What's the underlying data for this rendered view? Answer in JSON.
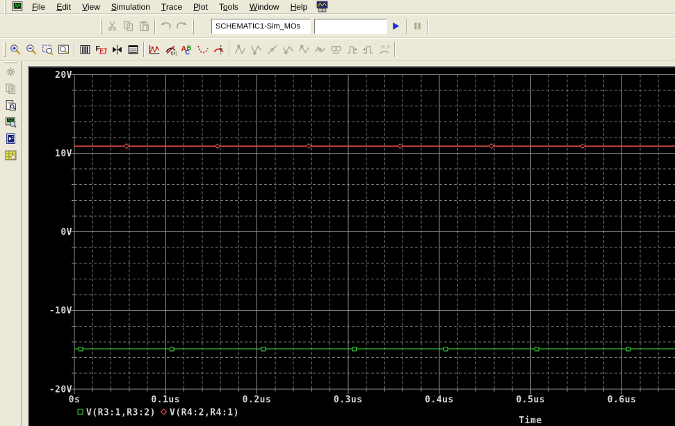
{
  "menu_bar": {
    "window_icon": "pspice-document-icon",
    "trailing_icon": "simulation-profile-icon",
    "items": [
      {
        "label": "File",
        "u": 0
      },
      {
        "label": "Edit",
        "u": 0
      },
      {
        "label": "View",
        "u": 0
      },
      {
        "label": "Simulation",
        "u": 0
      },
      {
        "label": "Trace",
        "u": 0
      },
      {
        "label": "Plot",
        "u": 0
      },
      {
        "label": "Tools",
        "u": 1
      },
      {
        "label": "Window",
        "u": 0
      },
      {
        "label": "Help",
        "u": 0
      }
    ]
  },
  "toolbar_standard": {
    "edit_buttons": [
      {
        "name": "cut-button",
        "icon": "scissors",
        "disabled": true
      },
      {
        "name": "copy-button",
        "icon": "copy",
        "disabled": true
      },
      {
        "name": "paste-button",
        "icon": "paste",
        "disabled": true
      },
      {
        "sep": true
      },
      {
        "name": "undo-button",
        "icon": "undo",
        "disabled": true
      },
      {
        "name": "redo-button",
        "icon": "redo",
        "disabled": true
      }
    ],
    "profile_combo": {
      "value": "SCHEMATIC1-Sim_MOs"
    },
    "status_field": {
      "value": ""
    },
    "run_buttons": [
      {
        "name": "run-button",
        "icon": "play",
        "disabled": false
      },
      {
        "sep": true
      },
      {
        "name": "pause-button",
        "icon": "pause",
        "disabled": true
      },
      {
        "sep": true
      }
    ]
  },
  "toolbar_plot": {
    "groups": [
      [
        {
          "name": "zoom-in-button",
          "icon": "zoom-in",
          "disabled": false
        },
        {
          "name": "zoom-out-button",
          "icon": "zoom-out",
          "disabled": false
        },
        {
          "name": "zoom-area-button",
          "icon": "zoom-area",
          "disabled": false
        },
        {
          "name": "zoom-fit-button",
          "icon": "zoom-fit",
          "disabled": false
        }
      ],
      [
        {
          "name": "plot-window-button",
          "icon": "plot-bars",
          "disabled": false
        },
        {
          "name": "fft-button",
          "icon": "fft",
          "disabled": false
        },
        {
          "name": "alternate-display-button",
          "icon": "alternate-display",
          "disabled": false
        },
        {
          "name": "view-output-list-button",
          "icon": "output-list",
          "disabled": false
        }
      ],
      [
        {
          "name": "add-trace-button",
          "icon": "add-trace",
          "disabled": false
        },
        {
          "name": "evaluate-measurement-button",
          "icon": "eval-measurement",
          "disabled": false
        },
        {
          "name": "label-button",
          "icon": "label-text",
          "disabled": false
        },
        {
          "name": "mark-data-points-button",
          "icon": "mark-points",
          "disabled": false
        },
        {
          "name": "toggle-cursor-button",
          "icon": "cursor-toggle",
          "disabled": false
        }
      ],
      [
        {
          "name": "cursor-peak-button",
          "icon": "cursor-peak",
          "disabled": true
        },
        {
          "name": "cursor-trough-button",
          "icon": "cursor-trough",
          "disabled": true
        },
        {
          "name": "cursor-slope-button",
          "icon": "cursor-slope",
          "disabled": true
        },
        {
          "name": "cursor-min-button",
          "icon": "cursor-min",
          "disabled": true
        },
        {
          "name": "cursor-max-button",
          "icon": "cursor-max",
          "disabled": true
        },
        {
          "name": "cursor-point-button",
          "icon": "cursor-point",
          "disabled": true
        },
        {
          "name": "cursor-search-button",
          "icon": "cursor-search",
          "disabled": true
        },
        {
          "name": "cursor-next-transition-button",
          "icon": "cursor-next-transition",
          "disabled": true
        },
        {
          "name": "cursor-prev-transition-button",
          "icon": "cursor-prev-transition",
          "disabled": true
        },
        {
          "name": "cursor-coordinates-button",
          "icon": "cursor-coordinates",
          "disabled": true
        }
      ]
    ]
  },
  "sidebar": {
    "buttons": [
      {
        "name": "simulation-queue-button",
        "icon": "sim-queue",
        "disabled": true
      },
      {
        "name": "simulation-messages-button",
        "icon": "sim-messages",
        "disabled": true
      },
      {
        "name": "view-output-file-button",
        "icon": "view-output-file",
        "disabled": false
      },
      {
        "name": "view-circuit-file-button",
        "icon": "view-circuit-file",
        "disabled": false
      },
      {
        "name": "view-simulation-results-button",
        "icon": "view-sim-results",
        "disabled": false
      },
      {
        "name": "view-schematic-button",
        "icon": "view-schematic",
        "disabled": false
      }
    ]
  },
  "chart_data": {
    "type": "line",
    "title": "",
    "xlabel": "Time",
    "ylabel": "",
    "x_unit": "us",
    "xlim_visible": [
      0,
      0.658
    ],
    "ylim": [
      -20,
      20
    ],
    "grid": true,
    "legend_position": "bottom-left",
    "x_ticks": [
      {
        "v": 0,
        "label": "0s"
      },
      {
        "v": 0.1,
        "label": "0.1us"
      },
      {
        "v": 0.2,
        "label": "0.2us"
      },
      {
        "v": 0.3,
        "label": "0.3us"
      },
      {
        "v": 0.4,
        "label": "0.4us"
      },
      {
        "v": 0.5,
        "label": "0.5us"
      },
      {
        "v": 0.6,
        "label": "0.6us"
      }
    ],
    "y_ticks": [
      {
        "v": 20,
        "label": "20V"
      },
      {
        "v": 10,
        "label": "10V"
      },
      {
        "v": 0,
        "label": "0V"
      },
      {
        "v": -10,
        "label": "-10V"
      },
      {
        "v": -20,
        "label": "-20V"
      }
    ],
    "x_minor_step": 0.02,
    "y_minor_step": 2,
    "colors": {
      "background": "#000000",
      "major": "#8f8f8f",
      "minor": "#757575",
      "text": "#d4d4d4"
    },
    "series": [
      {
        "name": "V(R3:1,R3:2)",
        "color": "#3ee23e",
        "marker": "square",
        "value_v": -14.9,
        "marker_times_us": [
          0.007,
          0.107,
          0.207,
          0.307,
          0.407,
          0.507,
          0.607
        ]
      },
      {
        "name": "V(R4:2,R4:1)",
        "color": "#f24c4c",
        "marker": "diamond",
        "value_v": 10.9,
        "marker_times_us": [
          0.057,
          0.157,
          0.257,
          0.357,
          0.457,
          0.557
        ]
      }
    ]
  }
}
